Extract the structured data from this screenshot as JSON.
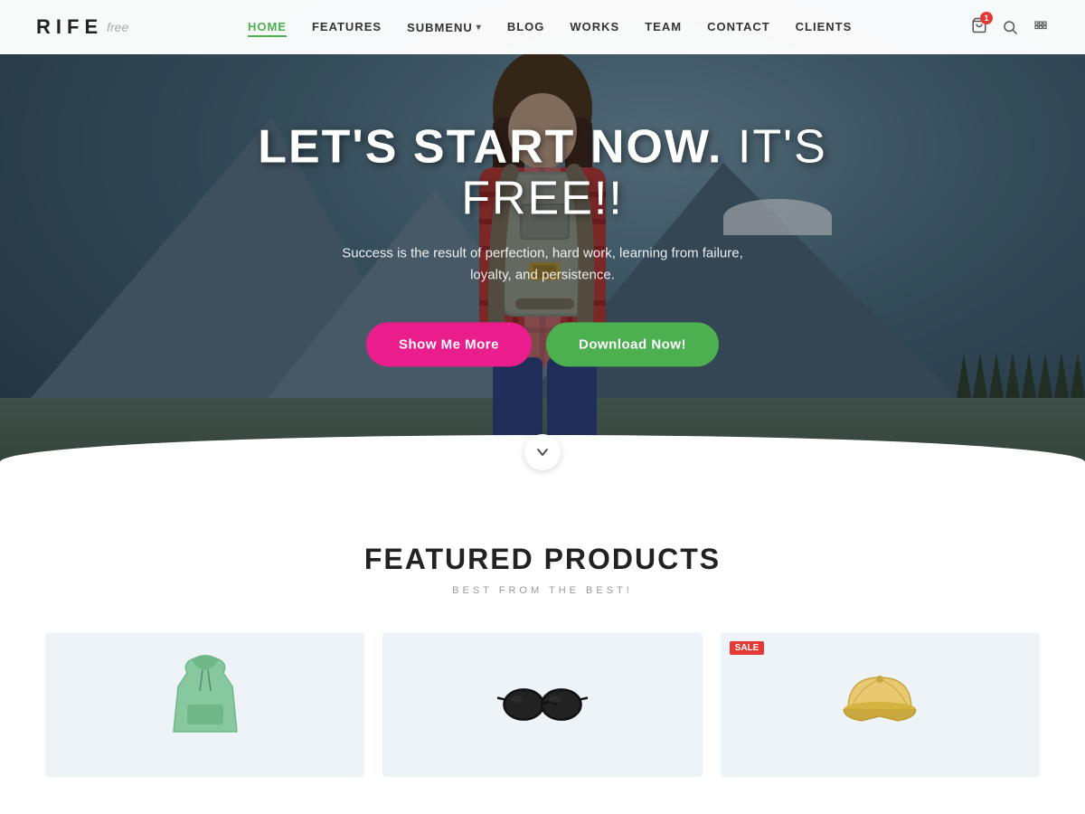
{
  "logo": {
    "rife": "RIFE",
    "free": "free"
  },
  "nav": {
    "links": [
      {
        "label": "HOME",
        "active": true,
        "id": "home"
      },
      {
        "label": "FEATURES",
        "active": false,
        "id": "features"
      },
      {
        "label": "SUBMENU",
        "active": false,
        "id": "submenu",
        "hasDropdown": true
      },
      {
        "label": "BLOG",
        "active": false,
        "id": "blog"
      },
      {
        "label": "WORKS",
        "active": false,
        "id": "works"
      },
      {
        "label": "TEAM",
        "active": false,
        "id": "team"
      },
      {
        "label": "CONTACT",
        "active": false,
        "id": "contact"
      },
      {
        "label": "CLIENTS",
        "active": false,
        "id": "clients"
      }
    ],
    "cart_count": "1"
  },
  "hero": {
    "title_bold": "LET'S START NOW.",
    "title_light": " IT'S FREE!!",
    "subtitle": "Success is the result of perfection, hard work, learning from failure, loyalty, and persistence.",
    "btn_show": "Show Me More",
    "btn_download": "Download Now!"
  },
  "featured": {
    "title": "FEATURED PRODUCTS",
    "subtitle": "BEST FROM THE BEST!",
    "products": [
      {
        "id": 1,
        "sale": false,
        "type": "hoodie"
      },
      {
        "id": 2,
        "sale": false,
        "type": "sunglasses"
      },
      {
        "id": 3,
        "sale": true,
        "type": "hat"
      }
    ]
  }
}
